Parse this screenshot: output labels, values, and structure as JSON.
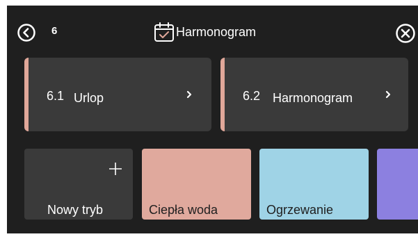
{
  "header": {
    "back_icon": "chevron-left-circle-icon",
    "breadcrumb": "6",
    "title_icon": "calendar-check-icon",
    "title": "Harmonogram",
    "close_icon": "close-circle-icon"
  },
  "nav_cards": [
    {
      "number": "6.1",
      "label": "Urlop",
      "accent": "#e0a799",
      "icon": "chevron-right-icon"
    },
    {
      "number": "6.2",
      "label": "Harmonogram",
      "accent": "#e0a799",
      "icon": "chevron-right-icon"
    }
  ],
  "tiles": [
    {
      "label": "Nowy tryb",
      "icon": "plus-icon",
      "color": "#3a3a3a"
    },
    {
      "label": "Ciepła woda",
      "color": "#e0a99d"
    },
    {
      "label": "Ogrzewanie",
      "color": "#9fd3e6"
    },
    {
      "label": "",
      "color": "#8c80e0"
    }
  ],
  "colors": {
    "background": "#1f1f1f",
    "card": "#3a3a3a",
    "accent": "#e0a799"
  }
}
